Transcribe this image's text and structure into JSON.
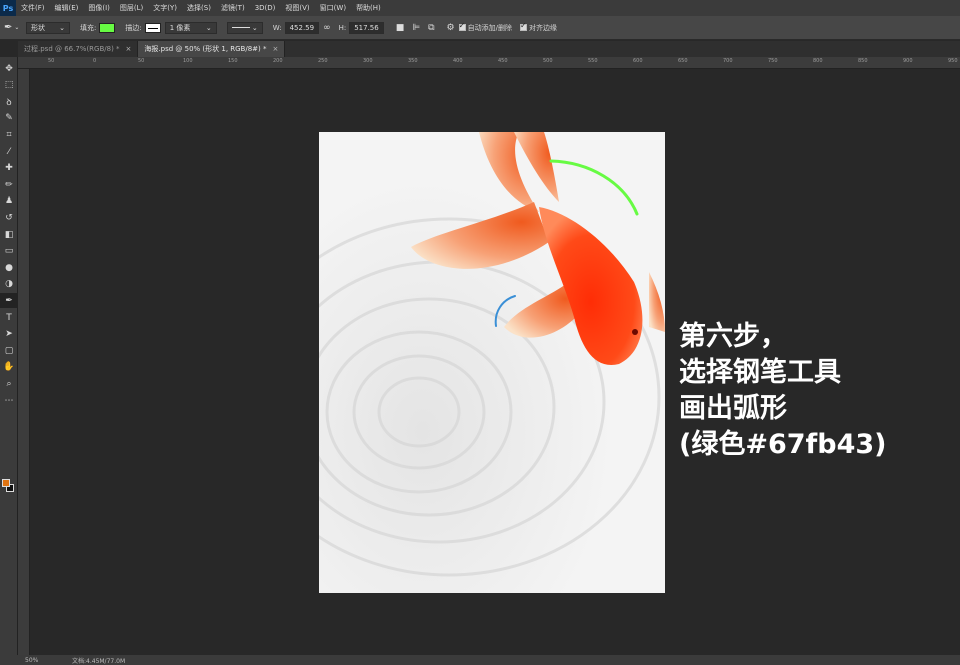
{
  "menubar": {
    "logo": "Ps",
    "items": [
      "文件(F)",
      "编辑(E)",
      "图像(I)",
      "图层(L)",
      "文字(Y)",
      "选择(S)",
      "滤镜(T)",
      "3D(D)",
      "视图(V)",
      "窗口(W)",
      "帮助(H)"
    ]
  },
  "options": {
    "mode": "形状",
    "fill_label": "填充:",
    "fill_color": "#67fb43",
    "stroke_label": "描边:",
    "stroke_width": "1 像素",
    "w_label": "W:",
    "w_value": "452.59",
    "h_label": "H:",
    "h_value": "517.56",
    "auto_add_delete": "自动添加/删除",
    "align_edges": "对齐边缘"
  },
  "tabs": [
    {
      "label": "过程.psd @ 66.7%(RGB/8) *",
      "close": "×"
    },
    {
      "label": "海报.psd @ 50% (形状 1, RGB/8#) *",
      "close": "×"
    }
  ],
  "ruler": {
    "ticks": [
      "50",
      "0",
      "50",
      "100",
      "150",
      "200",
      "250",
      "300",
      "350",
      "400",
      "450",
      "500",
      "550",
      "600",
      "650",
      "700",
      "750",
      "800",
      "850",
      "900",
      "950"
    ]
  },
  "tools": [
    "move-icon",
    "marquee-icon",
    "lasso-icon",
    "quick-select-icon",
    "crop-icon",
    "eyedropper-icon",
    "healing-icon",
    "brush-icon",
    "stamp-icon",
    "history-brush-icon",
    "eraser-icon",
    "gradient-icon",
    "blur-icon",
    "dodge-icon",
    "pen-icon",
    "type-icon",
    "path-select-icon",
    "shape-icon",
    "hand-icon",
    "zoom-icon",
    "more-icon"
  ],
  "colors": {
    "foreground": "#e07412",
    "background": "#111111",
    "arc_green": "#67fb43",
    "arc_blue": "#3a8fd6"
  },
  "caption": {
    "line1": "第六步，",
    "line2": "选择钢笔工具",
    "line3": "画出弧形",
    "line4": "(绿色#67fb43)"
  },
  "status": {
    "zoom": "50%",
    "doc_size": "文档:4.45M/77.0M"
  }
}
